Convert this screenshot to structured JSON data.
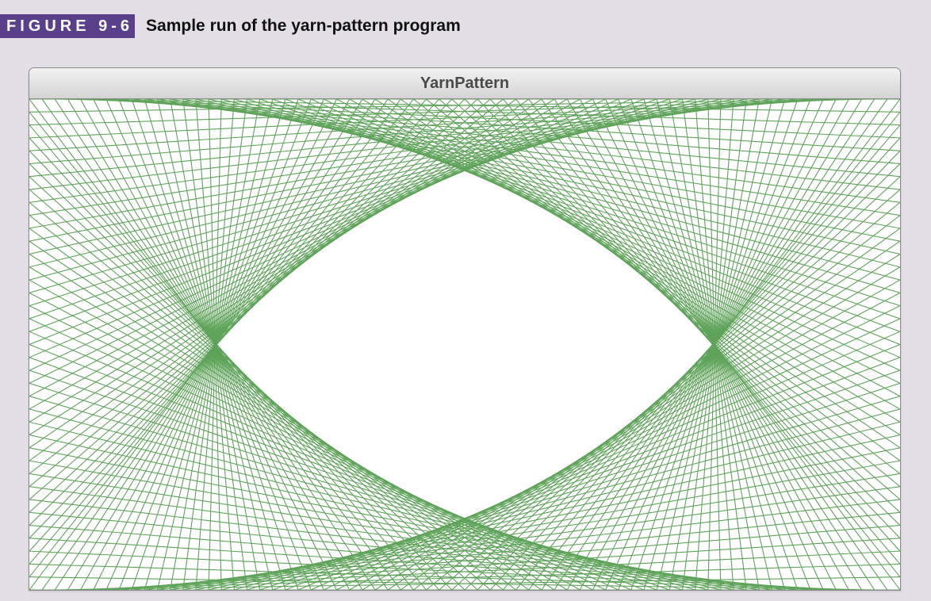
{
  "figure": {
    "label": "FIGURE 9-6",
    "caption": "Sample run of the yarn-pattern program"
  },
  "window": {
    "title": "YarnPattern"
  },
  "pattern": {
    "line_color": "#5fa35a",
    "background_color": "#ffffff"
  },
  "colors": {
    "page_background": "#e3dfe6",
    "figure_label_background": "#5a3f8a"
  }
}
